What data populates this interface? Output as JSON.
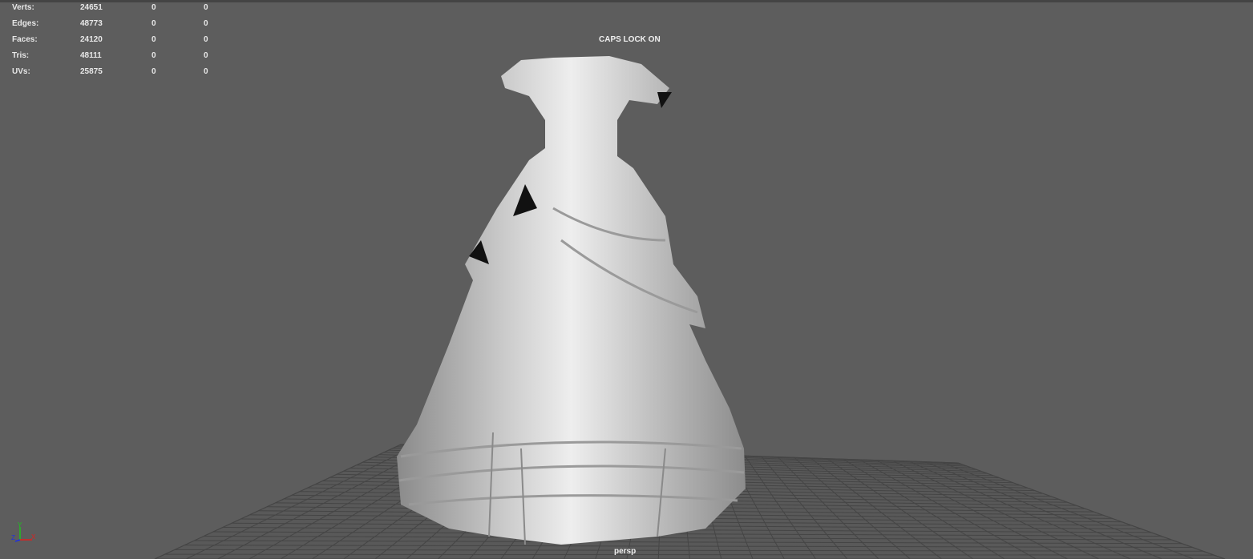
{
  "hud": {
    "rows": [
      {
        "label": "Verts:",
        "v1": "24651",
        "v2": "0",
        "v3": "0"
      },
      {
        "label": "Edges:",
        "v1": "48773",
        "v2": "0",
        "v3": "0"
      },
      {
        "label": "Faces:",
        "v1": "24120",
        "v2": "0",
        "v3": "0"
      },
      {
        "label": "Tris:",
        "v1": "48111",
        "v2": "0",
        "v3": "0"
      },
      {
        "label": "UVs:",
        "v1": "25875",
        "v2": "0",
        "v3": "0"
      }
    ]
  },
  "viewport": {
    "caps_lock": "CAPS LOCK ON",
    "camera": "persp",
    "axes": {
      "x": "X",
      "y": "Y",
      "z": "Z"
    },
    "colors": {
      "background": "#5d5d5d",
      "grid": "#3f3f3f",
      "model": "#c8c8c8",
      "x": "#e02020",
      "y": "#20c020",
      "z": "#2030e0"
    }
  }
}
